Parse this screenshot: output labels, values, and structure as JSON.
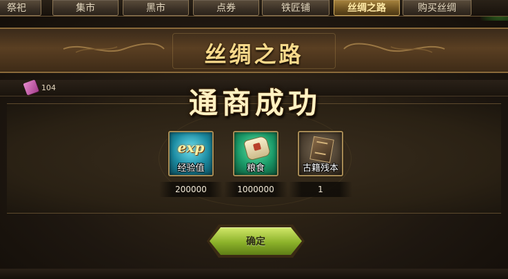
{
  "tabs": [
    {
      "label": "祭祀",
      "active": false
    },
    {
      "label": "集市",
      "active": false
    },
    {
      "label": "黑市",
      "active": false
    },
    {
      "label": "点券",
      "active": false
    },
    {
      "label": "铁匠铺",
      "active": false
    },
    {
      "label": "丝绸之路",
      "active": true
    },
    {
      "label": "购买丝绸",
      "active": false
    }
  ],
  "banner": {
    "title": "丝绸之路"
  },
  "resource": {
    "icon": "silk-scroll-icon",
    "value": "104"
  },
  "result": {
    "title": "通商成功"
  },
  "rewards": [
    {
      "icon": "exp-icon",
      "icon_text": "exp",
      "label": "经验值",
      "quantity": "200000"
    },
    {
      "icon": "grain-sack-icon",
      "label": "粮食",
      "quantity": "1000000"
    },
    {
      "icon": "ancient-book-icon",
      "label": "古籍残本",
      "quantity": "1"
    }
  ],
  "confirm_button": {
    "label": "确定"
  },
  "colors": {
    "accent_gold": "#f7d98b",
    "active_tab": "#a8843e",
    "confirm_green": "#8cb22a"
  }
}
